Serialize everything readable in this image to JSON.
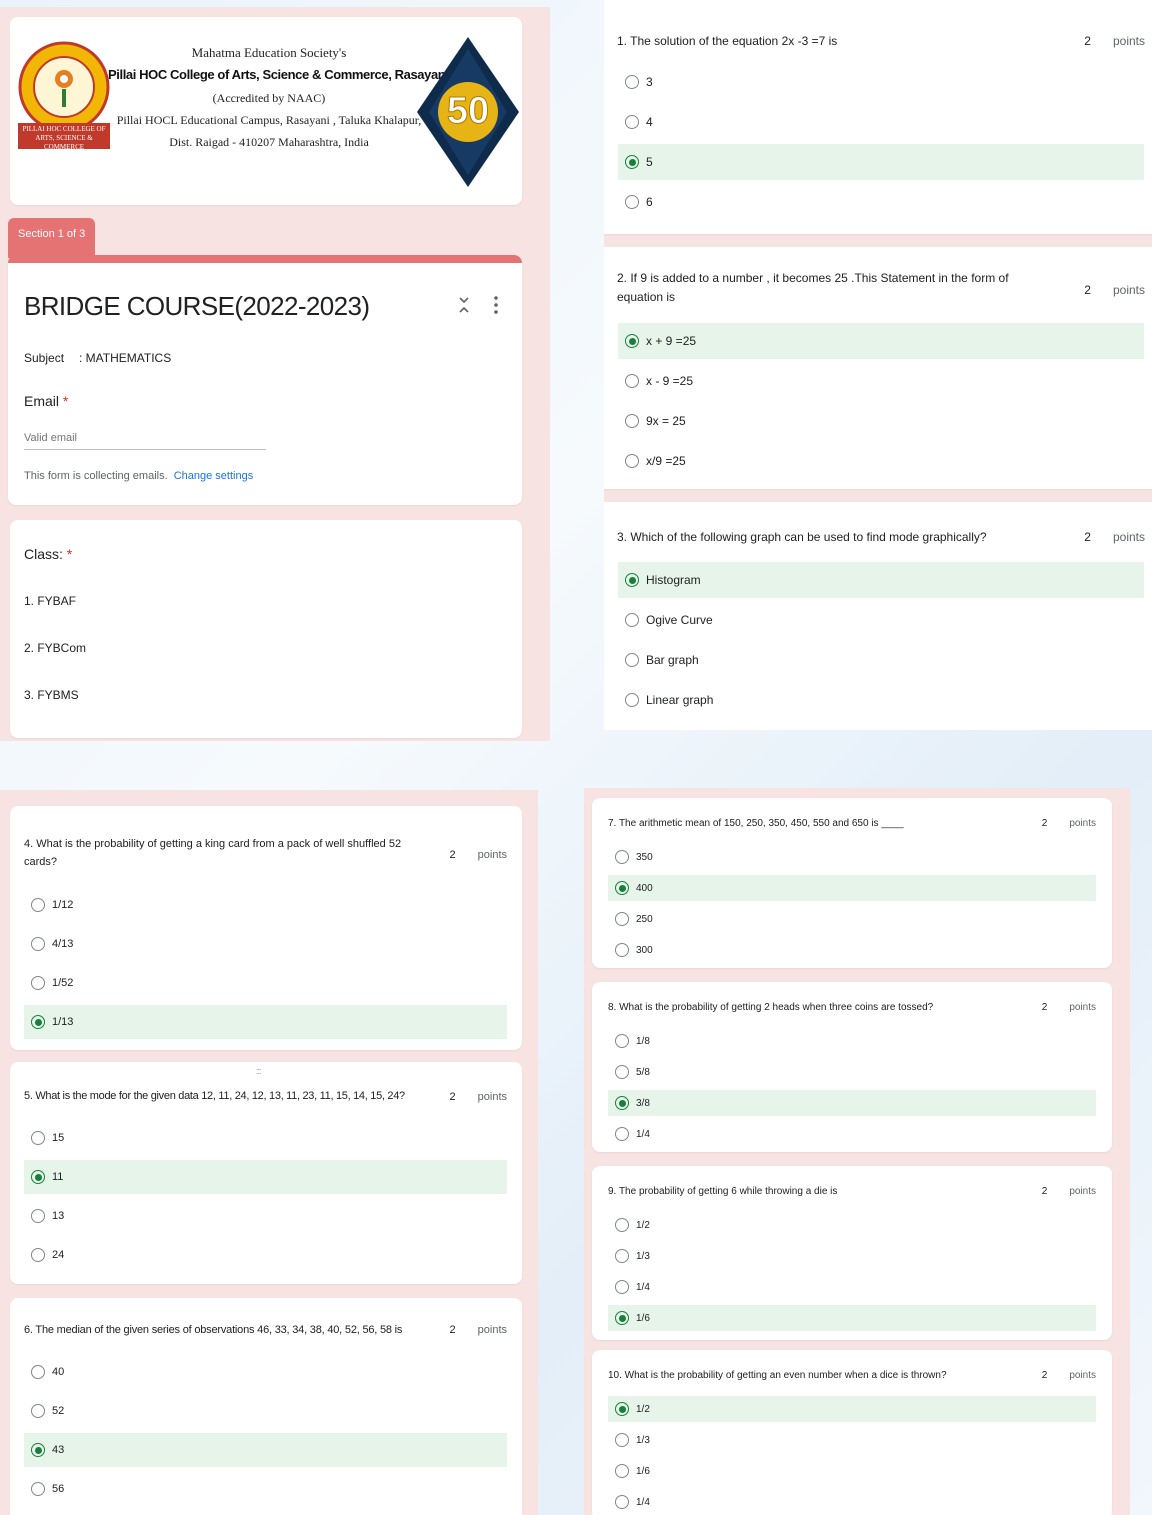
{
  "header": {
    "society": "Mahatma Education Society's",
    "college": "Pillai HOC College of Arts, Science & Commerce, Rasayani",
    "accreditation": "(Accredited by NAAC)",
    "campus": "Pillai HOCL Educational Campus, Rasayani , Taluka Khalapur,",
    "district": "Dist. Raigad - 410207 Maharashtra, India",
    "logo_left_text": "PILLAI HOC COLLEGE OF ARTS, SCIENCE & COMMERCE",
    "logo_right_number": "50"
  },
  "form": {
    "section_label": "Section 1 of 3",
    "title": "BRIDGE COURSE(2022-2023)",
    "subject_label": "Subject",
    "subject_value": ": MATHEMATICS",
    "email_label": "Email",
    "required_mark": "*",
    "email_placeholder": "Valid email",
    "collecting_note": "This form is collecting emails.",
    "change_settings": "Change settings",
    "class_label": "Class:",
    "class_options": [
      "1.  FYBAF",
      "2.  FYBCom",
      "3.  FYBMS"
    ],
    "collapse_icon": "collapse-icon",
    "more_icon": "more-vert-icon",
    "drag_handle": ":::"
  },
  "colors": {
    "selected_bg": "#e6f4ea",
    "radio_green": "#188038",
    "section_tab": "#e57373",
    "link": "#1a73e8",
    "required": "#d93025"
  },
  "questions": [
    {
      "text": "1. The solution of  the equation 2x -3 =7 is",
      "points": "2",
      "points_label": "points",
      "options": [
        "3",
        "4",
        "5",
        "6"
      ],
      "selected": 2
    },
    {
      "text": "2. If  9 is added to a number , it becomes 25 .This Statement in the form of equation is",
      "points": "2",
      "points_label": "points",
      "options": [
        "x + 9 =25",
        "x - 9 =25",
        "9x = 25",
        "x/9 =25"
      ],
      "selected": 0
    },
    {
      "text": "3. Which of the following graph can be used to find mode graphically?",
      "points": "2",
      "points_label": "points",
      "options": [
        "Histogram",
        "Ogive Curve",
        "Bar graph",
        "Linear graph"
      ],
      "selected": 0
    },
    {
      "text": "4. What is the probability of getting a king card from a pack of well shuffled 52 cards?",
      "points": "2",
      "points_label": "points",
      "options": [
        "1/12",
        "4/13",
        "1/52",
        "1/13"
      ],
      "selected": 3
    },
    {
      "text": "5. What is the mode for the given data 12, 11, 24, 12, 13, 11, 23, 11, 15, 14, 15, 24?",
      "points": "2",
      "points_label": "points",
      "options": [
        "15",
        "11",
        "13",
        "24"
      ],
      "selected": 1
    },
    {
      "text": "6. The median of the given series of observations 46, 33, 34, 38, 40, 52, 56, 58 is",
      "points": "2",
      "points_label": "points",
      "options": [
        "40",
        "52",
        "43",
        "56"
      ],
      "selected": 2
    },
    {
      "text": "7. The arithmetic mean of 150, 250, 350, 450, 550 and 650 is ____",
      "points": "2",
      "points_label": "points",
      "options": [
        "350",
        "400",
        "250",
        "300"
      ],
      "selected": 1
    },
    {
      "text": "8. What is the probability of getting 2 heads when three coins are tossed?",
      "points": "2",
      "points_label": "points",
      "options": [
        "1/8",
        "5/8",
        "3/8",
        "1/4"
      ],
      "selected": 2
    },
    {
      "text": "9. The probability of getting 6 while throwing a die is",
      "points": "2",
      "points_label": "points",
      "options": [
        "1/2",
        "1/3",
        "1/4",
        "1/6"
      ],
      "selected": 3
    },
    {
      "text": "10. What is the probability of getting an even number when a dice is thrown?",
      "points": "2",
      "points_label": "points",
      "options": [
        "1/2",
        "1/3",
        "1/6",
        "1/4"
      ],
      "selected": 0
    }
  ]
}
